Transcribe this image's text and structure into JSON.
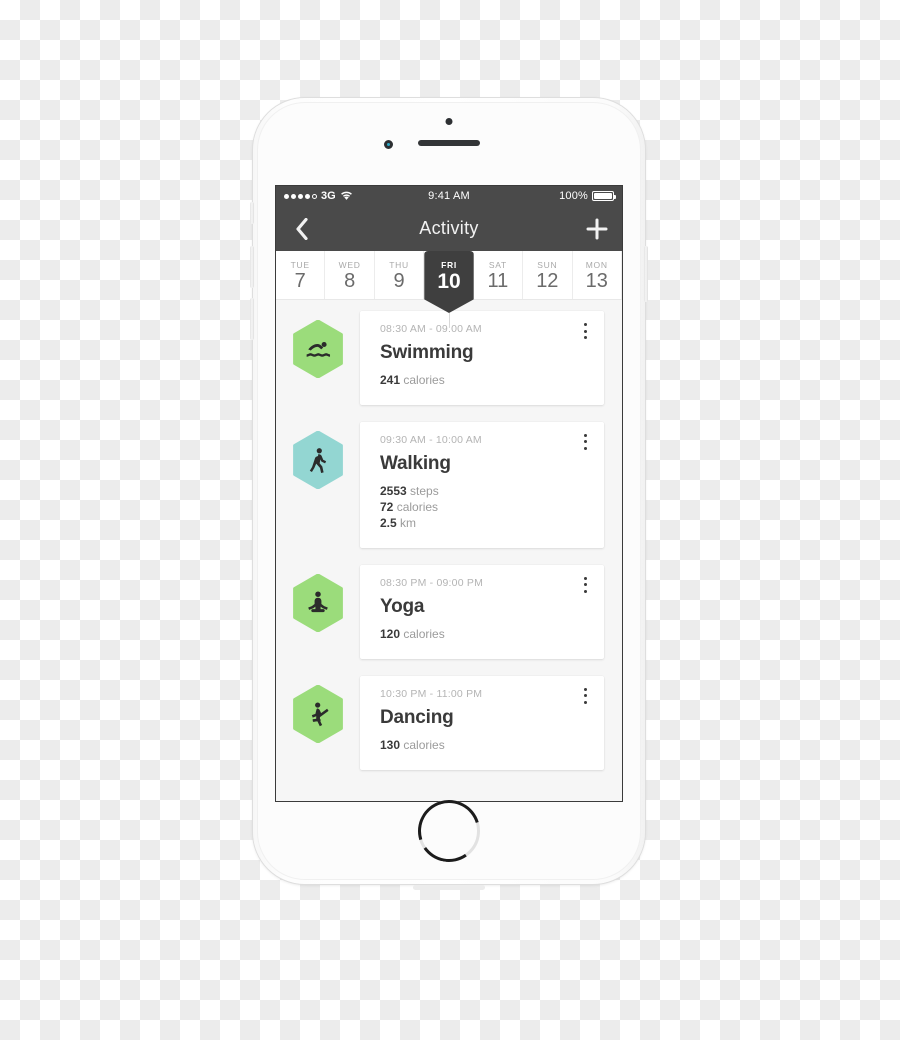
{
  "status_bar": {
    "signal_dots_filled": 4,
    "signal_dots_total": 5,
    "carrier": "3G",
    "wifi_icon": "wifi-icon",
    "time": "9:41 AM",
    "battery_percent": "100%",
    "battery_icon": "battery-full-icon"
  },
  "nav_bar": {
    "back_icon": "chevron-left-icon",
    "title": "Activity",
    "add_icon": "plus-icon"
  },
  "day_strip": {
    "days": [
      {
        "dow": "TUE",
        "num": "7",
        "active": false
      },
      {
        "dow": "WED",
        "num": "8",
        "active": false
      },
      {
        "dow": "THU",
        "num": "9",
        "active": false
      },
      {
        "dow": "FRI",
        "num": "10",
        "active": true
      },
      {
        "dow": "SAT",
        "num": "11",
        "active": false
      },
      {
        "dow": "SUN",
        "num": "12",
        "active": false
      },
      {
        "dow": "MON",
        "num": "13",
        "active": false
      }
    ]
  },
  "activities": [
    {
      "icon": "swimming-icon",
      "hex_color": "#9BDC7B",
      "time": "08:30 AM - 09:00 AM",
      "title": "Swimming",
      "stats": [
        {
          "value": "241",
          "unit": "calories"
        }
      ]
    },
    {
      "icon": "walking-icon",
      "hex_color": "#93D6D2",
      "time": "09:30 AM - 10:00 AM",
      "title": "Walking",
      "stats": [
        {
          "value": "2553",
          "unit": "steps"
        },
        {
          "value": "72",
          "unit": "calories"
        },
        {
          "value": "2.5",
          "unit": "km"
        }
      ]
    },
    {
      "icon": "yoga-icon",
      "hex_color": "#9BDC7B",
      "time": "08:30 PM - 09:00 PM",
      "title": "Yoga",
      "stats": [
        {
          "value": "120",
          "unit": "calories"
        }
      ]
    },
    {
      "icon": "dancing-icon",
      "hex_color": "#9BDC7B",
      "time": "10:30 PM - 11:00 PM",
      "title": "Dancing",
      "stats": [
        {
          "value": "130",
          "unit": "calories"
        }
      ]
    }
  ],
  "kebab_icon": "more-vertical-icon",
  "device": {
    "earpiece": "earpiece-speaker",
    "front_camera": "front-camera",
    "home_button": "home-button",
    "buttons": [
      "silent-switch",
      "volume-up-button",
      "volume-down-button",
      "power-button"
    ]
  },
  "colors": {
    "nav_background": "#4A4A4A",
    "accent_green": "#9BDC7B",
    "accent_teal": "#93D6D2",
    "screen_background": "#F6F6F6",
    "card_background": "#FFFFFF",
    "text_dark": "#3A3A3A",
    "text_muted": "#9B9B9B",
    "text_light": "#B4B4B4"
  }
}
